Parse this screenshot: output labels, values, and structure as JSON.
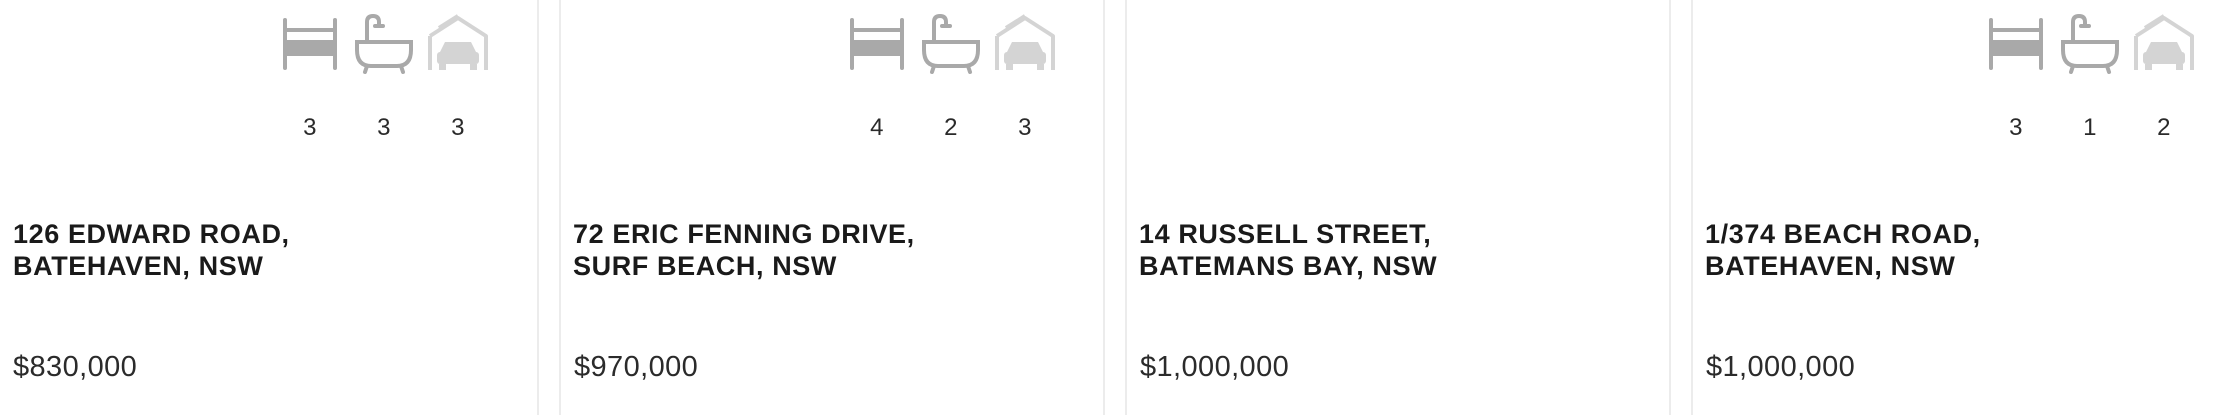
{
  "listings": [
    {
      "address_line1": "126 EDWARD ROAD,",
      "address_line2": "BATEHAVEN, NSW",
      "price": "$830,000",
      "features": {
        "beds": "3",
        "baths": "3",
        "cars": "3"
      }
    },
    {
      "address_line1": "72 ERIC FENNING DRIVE,",
      "address_line2": "SURF BEACH, NSW",
      "price": "$970,000",
      "features": {
        "beds": "4",
        "baths": "2",
        "cars": "3"
      }
    },
    {
      "address_line1": "14 RUSSELL STREET,",
      "address_line2": "BATEMANS BAY, NSW",
      "price": "$1,000,000"
    },
    {
      "address_line1": "1/374 BEACH ROAD,",
      "address_line2": "BATEHAVEN, NSW",
      "price": "$1,000,000",
      "features": {
        "beds": "3",
        "baths": "1",
        "cars": "2"
      }
    }
  ],
  "icons": {
    "bed": "bed-icon",
    "bath": "bathtub-icon",
    "car": "car-garage-icon"
  },
  "colors": {
    "icon_gray": "#a9a9a9",
    "icon_light": "#d4d4d4",
    "divider": "#ececec",
    "text": "#1a1a1a"
  }
}
